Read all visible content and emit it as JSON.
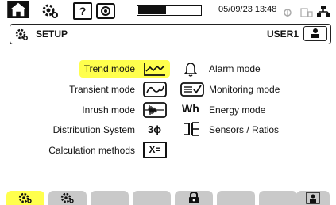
{
  "status_bar": {
    "datetime": "05/09/23 13:48",
    "battery_level": 0.45,
    "icons": [
      "home-icon",
      "gear-icon",
      "help-icon",
      "camera-icon",
      "battery-icon",
      "lock-status-icon",
      "sd-card-icon",
      "network-icon"
    ],
    "help_label": "?"
  },
  "header": {
    "title": "SETUP",
    "user": "USER1"
  },
  "menu": {
    "left": [
      {
        "label": "Trend mode",
        "icon": "trend-icon",
        "selected": true
      },
      {
        "label": "Transient mode",
        "icon": "transient-icon"
      },
      {
        "label": "Inrush mode",
        "icon": "inrush-icon"
      },
      {
        "label": "Distribution System",
        "icon": "three-phase-icon",
        "icon_text": "3ϕ"
      },
      {
        "label": "Calculation methods",
        "icon": "calculation-icon",
        "icon_text": "X="
      }
    ],
    "right": [
      {
        "label": "Alarm mode",
        "icon": "bell-icon"
      },
      {
        "label": "Monitoring mode",
        "icon": "monitoring-icon"
      },
      {
        "label": "Energy mode",
        "icon": "energy-icon",
        "icon_text": "Wh"
      },
      {
        "label": "Sensors / Ratios",
        "icon": "sensors-icon"
      }
    ]
  },
  "colors": {
    "highlight": "#ffff4d",
    "tab_inactive": "#c9c9c9",
    "text": "#111111"
  },
  "tabs": [
    {
      "icon": "gear-icon",
      "active": true
    },
    {
      "icon": "gear-icon",
      "active": false
    },
    {
      "icon": "",
      "active": false
    },
    {
      "icon": "",
      "active": false
    },
    {
      "icon": "lock-icon",
      "active": false
    },
    {
      "icon": "",
      "active": false
    },
    {
      "icon": "",
      "active": false
    },
    {
      "icon": "user-icon",
      "active": false
    }
  ]
}
